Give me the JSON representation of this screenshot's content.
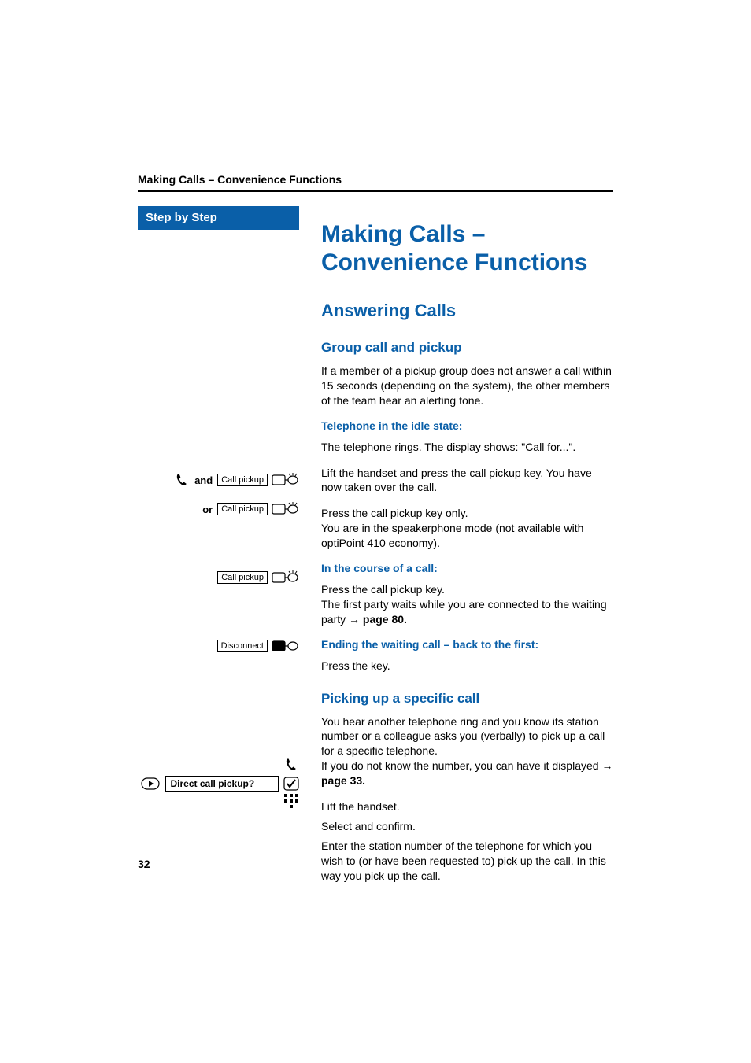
{
  "running_header": "Making Calls – Convenience Functions",
  "step_header": "Step by Step",
  "title": "Making Calls – Convenience Functions",
  "section1": "Answering Calls",
  "sub1": {
    "heading": "Group call and pickup",
    "p1": "If a member of a pickup group does not answer a call within 15 seconds (depending on the system), the other members of the team hear an alerting tone.",
    "state1": "Telephone in the idle state:",
    "p2": "The telephone rings. The display shows: \"Call for...\".",
    "p3": "Lift the handset and press the call pickup key. You have now taken over the call.",
    "p4a": "Press the call pickup key only.",
    "p4b": "You are in the speakerphone mode (not available with optiPoint 410 economy).",
    "state2": "In the course of a call:",
    "p5a": "Press the call pickup key.",
    "p5b": "The first party waits while you are connected to the waiting party ",
    "p5ref": "→ page 80.",
    "state3": "Ending the waiting call – back to the first:",
    "p6": "Press the key."
  },
  "sub2": {
    "heading": "Picking up a specific call",
    "p1a": "You hear another telephone ring and you know its station number or a colleague asks you (verbally) to pick up a call for a specific telephone.",
    "p1b": "If you do not know the number, you can have it displayed ",
    "p1ref": "→ page 33.",
    "p2": "Lift the handset.",
    "p3": "Select and confirm.",
    "p4": "Enter the station number of the telephone for which you wish to (or have been requested to) pick up the call. In this way you pick up the call."
  },
  "keys": {
    "call_pickup": "Call pickup",
    "disconnect": "Disconnect",
    "direct_call_pickup": "Direct call pickup?"
  },
  "labels": {
    "and": "and",
    "or": "or"
  },
  "page_number": "32"
}
